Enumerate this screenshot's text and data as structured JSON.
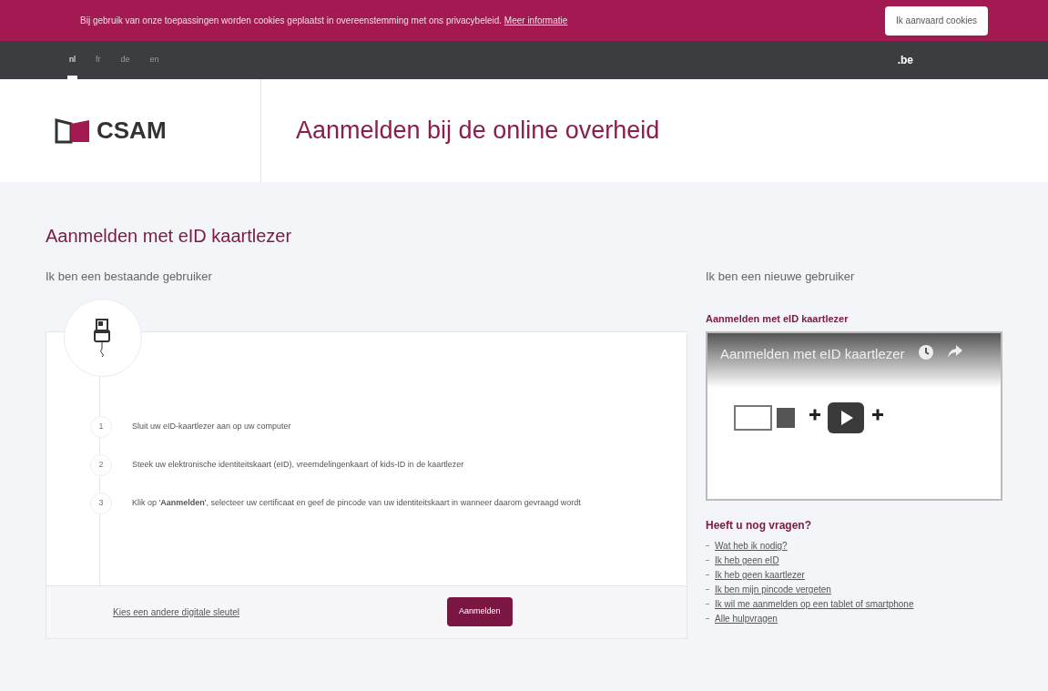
{
  "cookie_bar": {
    "text": "Bij gebruik van onze toepassingen worden cookies geplaatst in overeenstemming met ons privacybeleid.",
    "link": "Meer informatie",
    "button": "Ik aanvaard cookies"
  },
  "language_bar": {
    "languages": [
      {
        "label": "nl",
        "selected": true
      },
      {
        "label": "fr",
        "selected": false
      },
      {
        "label": "de",
        "selected": false
      },
      {
        "label": "en",
        "selected": false
      }
    ],
    "brand": ".be"
  },
  "header": {
    "logo": "CSAM",
    "title": "Aanmelden bij de online overheid"
  },
  "page_title": "Aanmelden met eID kaartlezer",
  "existing_user": {
    "heading": "Ik ben een bestaande gebruiker",
    "steps": [
      {
        "number": "1",
        "text": "Sluit uw eID-kaartlezer aan op uw computer"
      },
      {
        "number": "2",
        "text": "Steek uw elektronische identiteitskaart (eID), vreemdelingenkaart of kids-ID in de kaartlezer"
      },
      {
        "number": "3",
        "text": "Klik op '**Aanmelden**', selecteer uw certificaat en geef de pincode van uw identiteitskaart in wanneer daarom gevraagd wordt"
      }
    ],
    "other_key_link": "Kies een andere digitale sleutel",
    "login_button": "Aanmelden"
  },
  "new_user": {
    "heading": "Ik ben een nieuwe gebruiker",
    "video_heading": "Aanmelden met eID kaartlezer",
    "video": {
      "title": "Aanmelden met eID kaartlezer"
    },
    "faq_heading": "Heeft u nog vragen?",
    "faq_links": [
      "Wat heb ik nodig?",
      "Ik heb geen eID",
      "Ik heb geen kaartlezer",
      "Ik ben mijn pincode vergeten",
      "Ik wil me aanmelden op een tablet of smartphone",
      "Alle hulpvragen"
    ]
  }
}
